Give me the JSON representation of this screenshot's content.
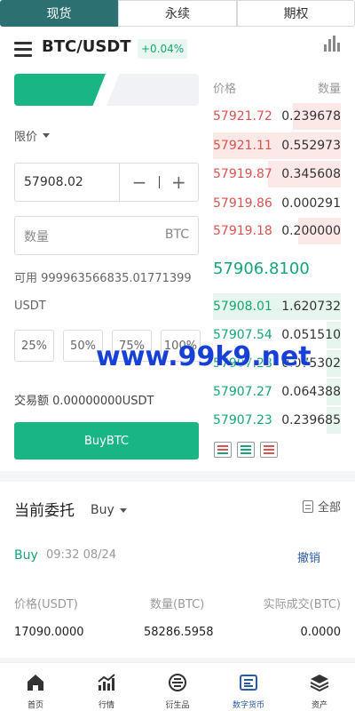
{
  "top_tabs": [
    "现货",
    "永续",
    "期权"
  ],
  "header": {
    "pair": "BTC/USDT",
    "change": "+0.04%"
  },
  "form": {
    "order_type": "限价",
    "price": "57908.02",
    "quantity_placeholder": "数量",
    "quantity_unit": "BTC",
    "available_line1": "可用 999963566835.01771399",
    "available_line2": "USDT",
    "percents": [
      "25%",
      "50%",
      "75%",
      "100%"
    ],
    "trade_amount": "交易额 0.00000000USDT",
    "buy_button": "BuyBTC"
  },
  "order_book": {
    "price_header": "价格",
    "qty_header": "数量",
    "asks": [
      {
        "price": "57921.72",
        "qty": "0.239678"
      },
      {
        "price": "57921.11",
        "qty": "0.552973"
      },
      {
        "price": "57919.87",
        "qty": "0.345608"
      },
      {
        "price": "57919.86",
        "qty": "0.000291"
      },
      {
        "price": "57919.18",
        "qty": "0.200000"
      }
    ],
    "last_price": "57906.8100",
    "bids": [
      {
        "price": "57908.01",
        "qty": "1.620732"
      },
      {
        "price": "57907.54",
        "qty": "0.051510"
      },
      {
        "price": "57907.28",
        "qty": "0.075302"
      },
      {
        "price": "57907.27",
        "qty": "0.064388"
      },
      {
        "price": "57907.23",
        "qty": "0.239685"
      }
    ]
  },
  "watermark": "www.99k9.net",
  "orders": {
    "title": "当前委托",
    "filter": "Buy",
    "all_label": "全部",
    "side": "Buy",
    "time": "09:32 08/24",
    "cancel": "撤销",
    "col_price": "价格(USDT)",
    "col_qty": "数量(BTC)",
    "col_filled": "实际成交(BTC)",
    "price": "17090.0000",
    "qty": "58286.5958",
    "filled": "0.0000"
  },
  "nav": [
    "首页",
    "行情",
    "衍生品",
    "数字货币",
    "资产"
  ],
  "colors": {
    "up": "#17a576",
    "down": "#d9534f",
    "tab_active": "#2d7071",
    "accent": "#2a5b9f"
  }
}
